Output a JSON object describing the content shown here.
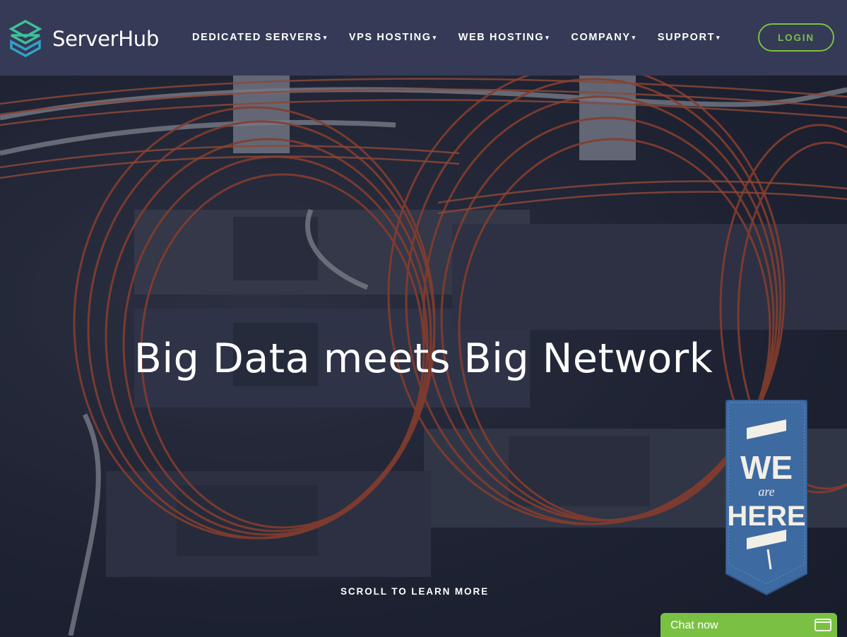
{
  "brand": {
    "name": "ServerHub",
    "icon": "cube-logo-icon",
    "accent": "#7ac143"
  },
  "nav": {
    "items": [
      {
        "label": "DEDICATED SERVERS"
      },
      {
        "label": "VPS HOSTING"
      },
      {
        "label": "WEB HOSTING"
      },
      {
        "label": "COMPANY"
      },
      {
        "label": "SUPPORT"
      }
    ],
    "login_label": "LOGIN"
  },
  "hero": {
    "headline": "Big Data meets Big Network",
    "scroll_label": "SCROLL TO LEARN MORE",
    "background": "fiber-cable-server-rack-photo"
  },
  "badge": {
    "line1": "WE",
    "line2": "are",
    "line3": "HERE"
  },
  "chat": {
    "label": "Chat now",
    "icon": "chat-window-icon"
  },
  "colors": {
    "navbar": "#353a56",
    "accent_green": "#7ac143",
    "badge_blue": "#3e6aa2"
  }
}
